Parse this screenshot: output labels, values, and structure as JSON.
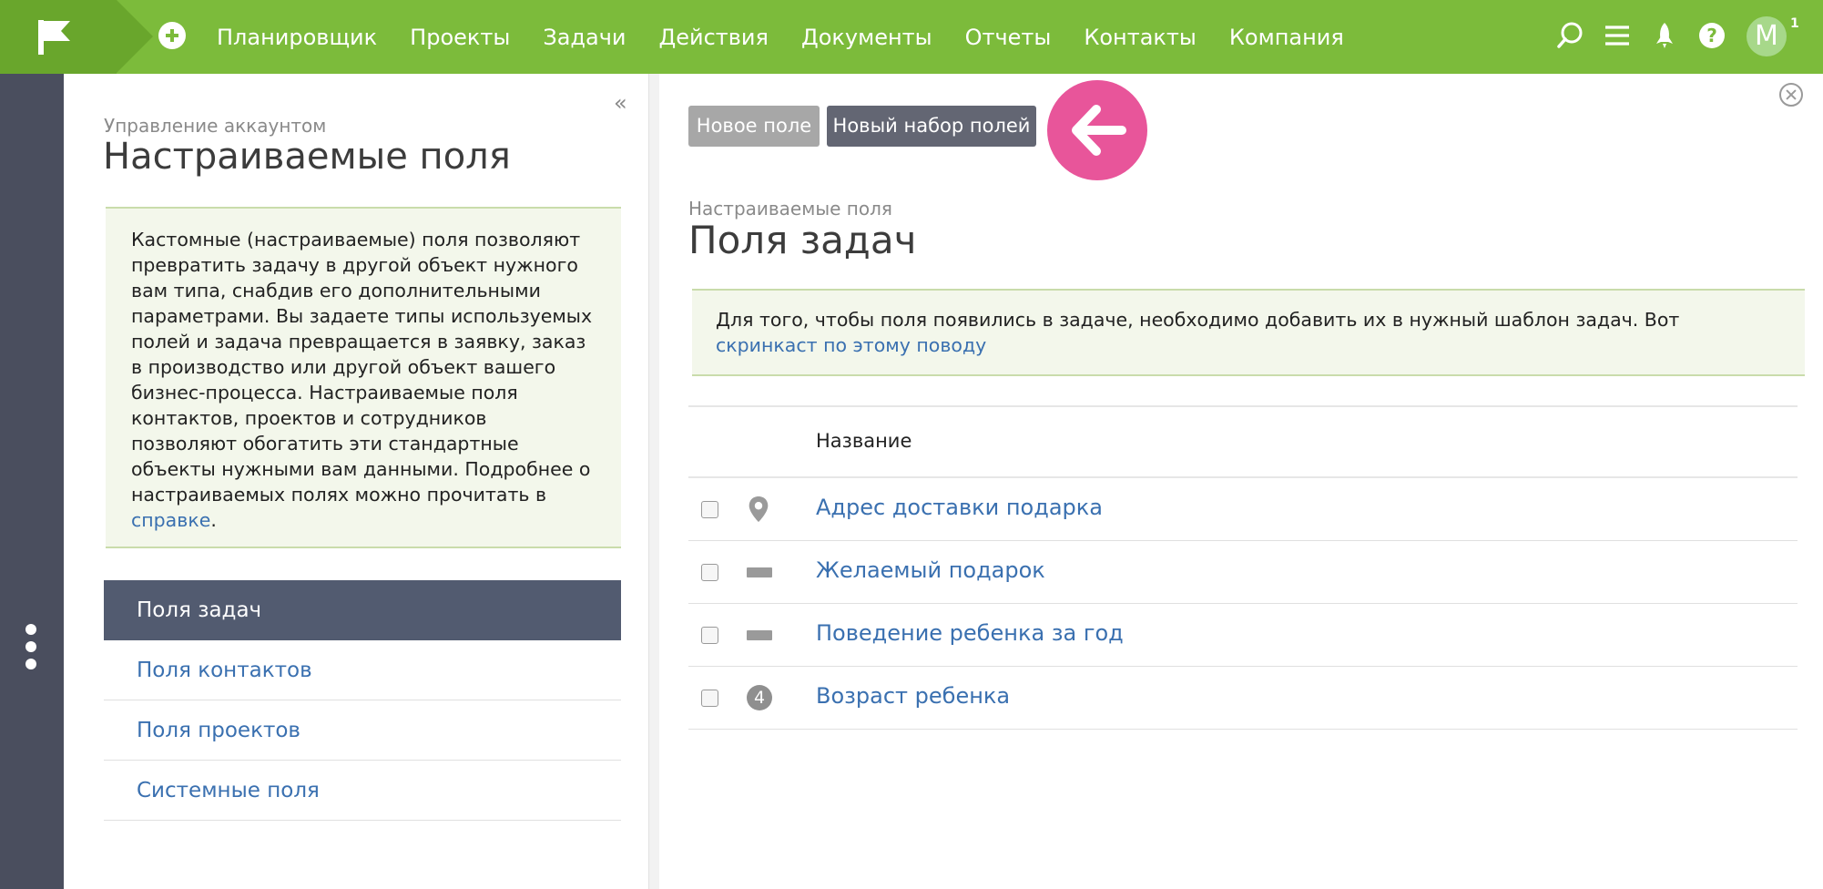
{
  "header": {
    "nav": [
      "Планировщик",
      "Проекты",
      "Задачи",
      "Действия",
      "Документы",
      "Отчеты",
      "Контакты",
      "Компания"
    ],
    "avatar_letter": "M",
    "notification_count": "1",
    "icons": [
      "flag-logo-icon",
      "plus-icon",
      "search-icon",
      "menu-icon",
      "rocket-icon",
      "help-icon"
    ]
  },
  "left_panel": {
    "subtitle": "Управление аккаунтом",
    "title": "Настраиваемые поля",
    "info_text": "Кастомные (настраиваемые) поля позволяют превратить задачу в другой объект нужного вам типа, снабдив его дополнительными параметрами. Вы задаете типы используемых полей и задача превращается в заявку, заказ в производство или другой объект вашего бизнес-процесса. Настраиваемые поля контактов, проектов и сотрудников позволяют обогатить эти стандартные объекты нужными вам данными. Подробнее о настраиваемых полях можно прочитать в ",
    "info_link": "справке",
    "info_end": ".",
    "menu": [
      {
        "label": "Поля задач",
        "active": true
      },
      {
        "label": "Поля контактов",
        "active": false
      },
      {
        "label": "Поля проектов",
        "active": false
      },
      {
        "label": "Системные поля",
        "active": false
      }
    ]
  },
  "main": {
    "buttons": {
      "new_field": "Новое поле",
      "new_field_set": "Новый набор полей"
    },
    "subtitle": "Настраиваемые поля",
    "title": "Поля задач",
    "notice_text": "Для того, чтобы поля появились в задаче, необходимо добавить их в нужный шаблон задач. Вот ",
    "notice_link": "скринкаст по этому поводу",
    "table": {
      "header_name": "Название",
      "rows": [
        {
          "name": "Адрес доставки подарка",
          "icon": "map-pin-icon"
        },
        {
          "name": "Желаемый подарок",
          "icon": "text-field-icon"
        },
        {
          "name": "Поведение ребенка за год",
          "icon": "text-field-icon"
        },
        {
          "name": "Возраст ребенка",
          "icon": "number-field-icon",
          "icon_text": "4"
        }
      ]
    }
  },
  "colors": {
    "topbar": "#7cbb3b",
    "sidebar": "#4a4e5e",
    "active_menu": "#525b70",
    "link": "#3a70b0",
    "highlight": "#e8559a"
  }
}
